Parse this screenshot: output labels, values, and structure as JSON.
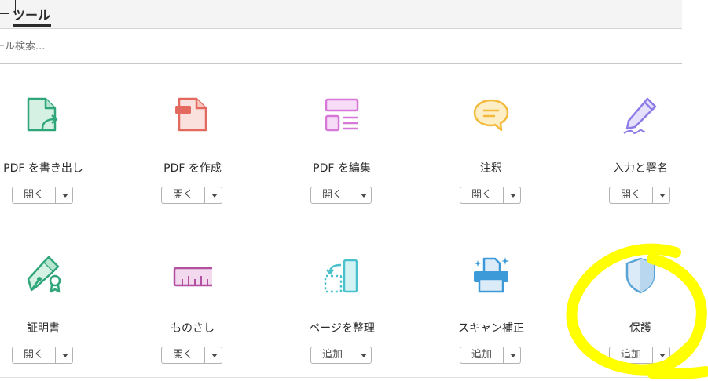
{
  "header": {
    "active_tab": "ツール"
  },
  "search": {
    "placeholder": "ツール検索..."
  },
  "tools": [
    {
      "label": "PDF を書き出し",
      "button": "開く",
      "icon": "export-pdf-icon"
    },
    {
      "label": "PDF を作成",
      "button": "開く",
      "icon": "create-pdf-icon"
    },
    {
      "label": "PDF を編集",
      "button": "開く",
      "icon": "edit-pdf-icon"
    },
    {
      "label": "注釈",
      "button": "開く",
      "icon": "comment-icon"
    },
    {
      "label": "入力と署名",
      "button": "開く",
      "icon": "fill-sign-icon"
    },
    {
      "label": "証明書",
      "button": "開く",
      "icon": "certificate-icon"
    },
    {
      "label": "ものさし",
      "button": "開く",
      "icon": "ruler-icon"
    },
    {
      "label": "ページを整理",
      "button": "追加",
      "icon": "organize-pages-icon"
    },
    {
      "label": "スキャン補正",
      "button": "追加",
      "icon": "scan-icon"
    },
    {
      "label": "保護",
      "button": "追加",
      "icon": "shield-icon"
    }
  ],
  "colors": {
    "export": "#2ea67a",
    "create": "#e46a5f",
    "edit": "#d777d7",
    "comment": "#f2b93b",
    "fill_sign": "#8e7ce8",
    "certificate": "#2ea67a",
    "ruler": "#b34fa0",
    "organize": "#48c1cc",
    "scan": "#3d9ad8",
    "protect": "#5aa3d6",
    "annotation_highlight": "#ffff00"
  }
}
